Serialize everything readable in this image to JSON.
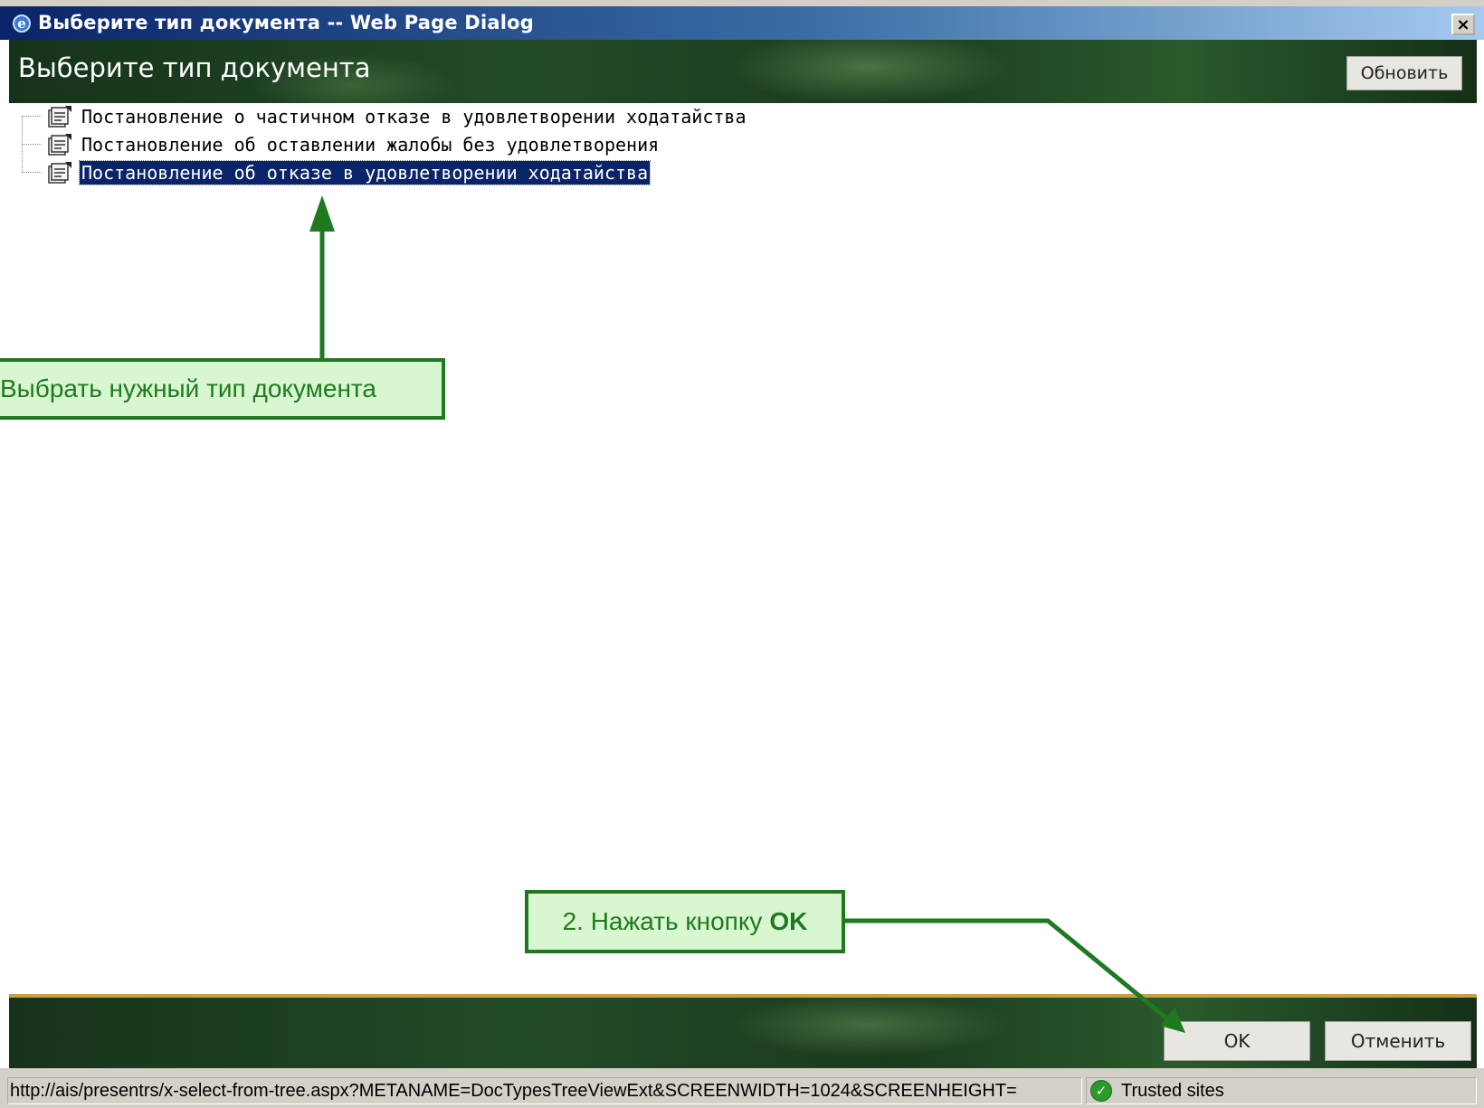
{
  "window": {
    "title": "Выберите тип документа -- Web Page Dialog",
    "close_label": "×"
  },
  "header": {
    "heading": "Выберите тип документа",
    "refresh_label": "Обновить"
  },
  "tree": {
    "items": [
      {
        "label": "Постановление о частичном отказе в удовлетворении ходатайства",
        "selected": false
      },
      {
        "label": "Постановление об оставлении жалобы без удовлетворения",
        "selected": false
      },
      {
        "label": "Постановление об отказе в удовлетворении ходатайства",
        "selected": true
      }
    ]
  },
  "footer": {
    "ok_label": "OK",
    "cancel_label": "Отменить"
  },
  "statusbar": {
    "url": "http://ais/presentrs/x-select-from-tree.aspx?METANAME=DocTypesTreeViewExt&SCREENWIDTH=1024&SCREENHEIGHT=",
    "zone": "Trusted sites"
  },
  "callouts": {
    "step1": "Выбрать нужный тип документа",
    "step2_prefix": "2. Нажать кнопку",
    "step2_bold": "OK"
  },
  "colors": {
    "title_gradient_start": "#0a246a",
    "banner_green": "#234a26",
    "selection": "#0a246a",
    "callout_fill": "#d8f7d0",
    "callout_stroke": "#1f7a1f",
    "footer_border": "#c8a040"
  }
}
